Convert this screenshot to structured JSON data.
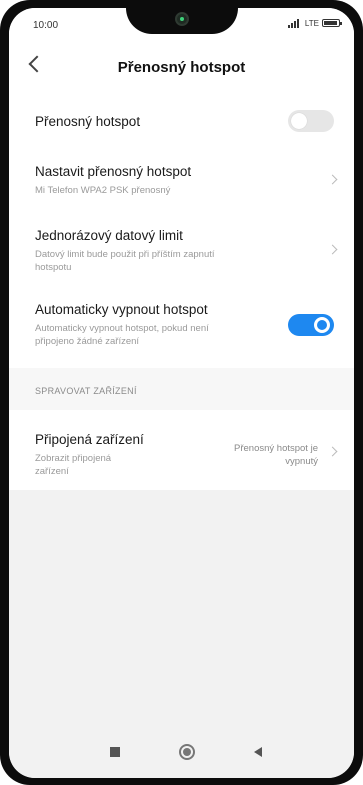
{
  "status": {
    "time": "10:00",
    "network": "LTE"
  },
  "header": {
    "title": "Přenosný hotspot"
  },
  "settings": {
    "hotspot": {
      "title": "Přenosný hotspot",
      "enabled": false
    },
    "configure": {
      "title": "Nastavit přenosný hotspot",
      "subtitle": "Mi Telefon WPA2 PSK přenosný"
    },
    "data_limit": {
      "title": "Jednorázový datový limit",
      "subtitle_line1": "Datový limit bude použit při příštím zapnutí",
      "subtitle_line2": "hotspotu"
    },
    "auto_off": {
      "title": "Automaticky vypnout hotspot",
      "subtitle_line1": "Automaticky vypnout hotspot, pokud není",
      "subtitle_line2": "připojeno žádné zařízení",
      "enabled": true
    }
  },
  "manage": {
    "section_label": "SPRAVOVAT ZAŘÍZENÍ",
    "connected": {
      "title": "Připojená zařízení",
      "subtitle_line1": "Zobrazit připojená",
      "subtitle_line2": "zařízení",
      "value_line1": "Přenosný hotspot je",
      "value_line2": "vypnutý"
    }
  },
  "colors": {
    "accent": "#1e88f0",
    "toggle_off": "#e6e6e6"
  },
  "icons": [
    "back-icon",
    "chevron-right-icon",
    "recent-apps-icon",
    "home-icon",
    "nav-back-icon",
    "signal-icon",
    "battery-icon"
  ]
}
